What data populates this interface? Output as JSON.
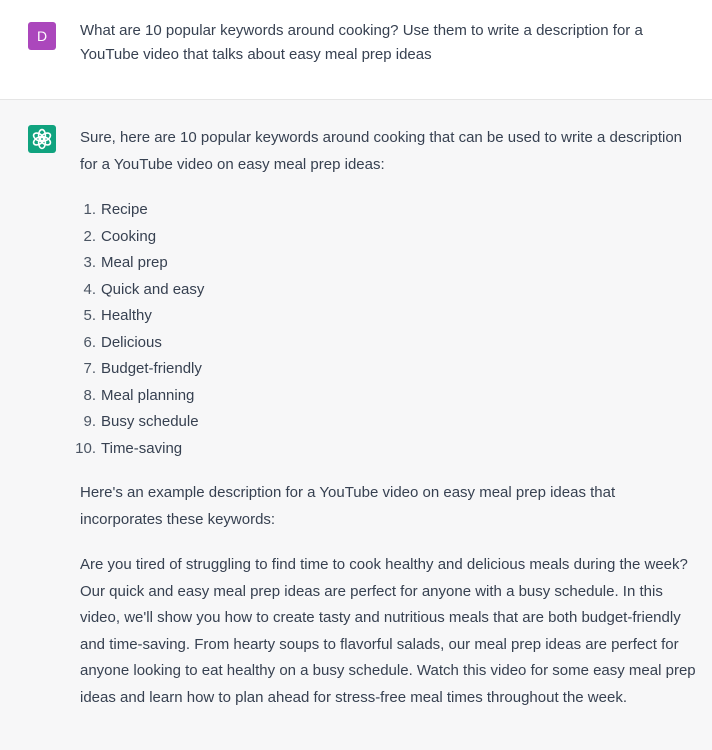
{
  "user": {
    "avatar_letter": "D",
    "avatar_color": "#ab47bc",
    "message": "What are 10 popular keywords around cooking? Use them to write a description for a YouTube video that talks about easy meal prep ideas"
  },
  "assistant": {
    "avatar_icon": "openai-logo-icon",
    "avatar_color": "#10a37f",
    "intro": "Sure, here are 10 popular keywords around cooking that can be used to write a description for a YouTube video on easy meal prep ideas:",
    "keywords": [
      {
        "num": "1.",
        "text": "Recipe"
      },
      {
        "num": "2.",
        "text": "Cooking"
      },
      {
        "num": "3.",
        "text": "Meal prep"
      },
      {
        "num": "4.",
        "text": "Quick and easy"
      },
      {
        "num": "5.",
        "text": "Healthy"
      },
      {
        "num": "6.",
        "text": "Delicious"
      },
      {
        "num": "7.",
        "text": "Budget-friendly"
      },
      {
        "num": "8.",
        "text": "Meal planning"
      },
      {
        "num": "9.",
        "text": "Busy schedule"
      },
      {
        "num": "10.",
        "text": "Time-saving"
      }
    ],
    "example_intro": "Here's an example description for a YouTube video on easy meal prep ideas that incorporates these keywords:",
    "description": "Are you tired of struggling to find time to cook healthy and delicious meals during the week? Our quick and easy meal prep ideas are perfect for anyone with a busy schedule. In this video, we'll show you how to create tasty and nutritious meals that are both budget-friendly and time-saving. From hearty soups to flavorful salads, our meal prep ideas are perfect for anyone looking to eat healthy on a busy schedule. Watch this video for some easy meal prep ideas and learn how to plan ahead for stress-free meal times throughout the week."
  }
}
